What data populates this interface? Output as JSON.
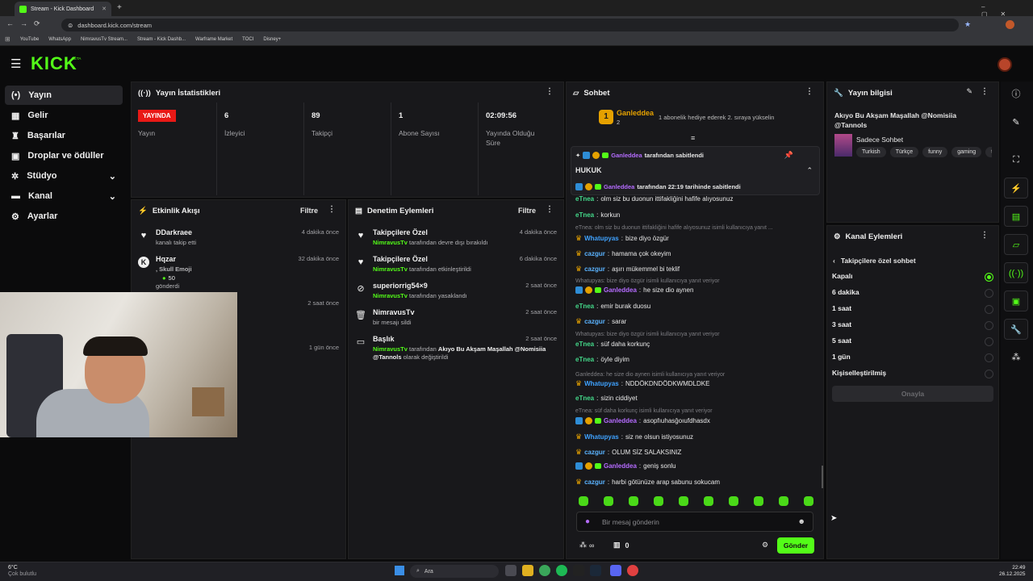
{
  "browser": {
    "tab_title": "Stream - Kick Dashboard",
    "url": "dashboard.kick.com/stream",
    "bookmarks": [
      "YouTube",
      "WhatsApp",
      "NimravusTv Stream...",
      "Stream - Kick Dashb...",
      "Warframe Market",
      "TOCI",
      "Disney+"
    ]
  },
  "site": {
    "logo": "KICK",
    "beta": "BETA"
  },
  "nav": {
    "items": [
      {
        "label": "Yayın",
        "icon": "broadcast-icon"
      },
      {
        "label": "Gelir",
        "icon": "money-icon"
      },
      {
        "label": "Başarılar",
        "icon": "trophy-icon"
      },
      {
        "label": "Droplar ve ödüller",
        "icon": "gift-icon"
      },
      {
        "label": "Stüdyo",
        "icon": "studio-icon"
      },
      {
        "label": "Kanal",
        "icon": "channel-icon"
      },
      {
        "label": "Ayarlar",
        "icon": "gear-icon"
      }
    ]
  },
  "stats": {
    "title": "Yayın İstatistikleri",
    "live_badge": "YAYINDA",
    "live_label": "Yayın",
    "items": [
      {
        "value": "6",
        "label": "İzleyici"
      },
      {
        "value": "89",
        "label": "Takipçi"
      },
      {
        "value": "1",
        "label": "Abone Sayısı"
      },
      {
        "value": "02:09:56",
        "label": "Yayında Olduğu Süre"
      }
    ]
  },
  "activity": {
    "title": "Etkinlik Akışı",
    "filter": "Filtre",
    "items": [
      {
        "name": "DDarkraee",
        "sub": "kanalı takip etti",
        "time": "4 dakika önce"
      },
      {
        "name": "Hqzar",
        "sub": ", Skull Emoji",
        "amount": "50",
        "sub2": "gönderdi",
        "time": "32 dakika önce"
      },
      {
        "time": "2 saat önce"
      },
      {
        "time": "1 gün önce"
      }
    ]
  },
  "moderation": {
    "title": "Denetim Eylemleri",
    "filter": "Filtre",
    "items": [
      {
        "title": "Takipçilere Özel",
        "actor": "NimravusTv",
        "action": "tarafından devre dışı bırakıldı",
        "time": "4 dakika önce"
      },
      {
        "title": "Takipçilere Özel",
        "actor": "NimravusTv",
        "action": "tarafından etkinleştirildi",
        "time": "6 dakika önce"
      },
      {
        "title": "superiorrig54×9",
        "actor": "NimravusTv",
        "action": "tarafından yasaklandı",
        "time": "2 saat önce"
      },
      {
        "title": "NimravusTv",
        "action": "bir mesajı sildi",
        "time": "2 saat önce"
      },
      {
        "title": "Başlık",
        "actor": "NimravusTv",
        "action": "tarafından",
        "target": "Akıyo Bu Akşam Maşallah @Nomisiia @Tannols",
        "action2": "olarak değiştirildi",
        "time": "2 saat önce"
      }
    ]
  },
  "chat": {
    "title": "Sohbet",
    "top_user": "Ganleddea",
    "top_rank": "1",
    "top_count": "2",
    "top_text": "1 abonelik hediye ederek 2. sıraya yükselin",
    "pinned_by": "Ganleddea",
    "pinned_label": "tarafından sabitlendi",
    "pinned_msg": "HUKUK",
    "pinned_time": "tarafından 22:19 tarihinde sabitlendi",
    "messages": [
      {
        "user": "eTnea",
        "text": "olm siz bu duonun ittifakliğini hafife alıyosunuz"
      },
      {
        "user": "eTnea",
        "text": "korkun"
      },
      {
        "reply": "eTnea: olm siz bu duonun ittifakliğini hafife alıyosunuz isimli kullanıcıya yanıt ..."
      },
      {
        "user": "Whatupyas",
        "text": "bize diyo özgür"
      },
      {
        "user": "cazgur",
        "text": "hamama çok okeyim"
      },
      {
        "user": "cazgur",
        "text": "aşırı mükemmel bi teklif"
      },
      {
        "reply": "Whatupyas: bize diyo özgür isimli kullanıcıya yanıt veriyor"
      },
      {
        "user": "Ganleddea",
        "text": "he size dio aynen"
      },
      {
        "user": "eTnea",
        "text": "emir burak duosu"
      },
      {
        "user": "cazgur",
        "text": "sarar"
      },
      {
        "reply": "Whatupyas: bize diyo özgür isimli kullanıcıya yanıt veriyor"
      },
      {
        "user": "eTnea",
        "text": "süf daha korkunç"
      },
      {
        "user": "eTnea",
        "text": "öyle diyim"
      },
      {
        "reply": "Ganleddea: he size dio aynen isimli kullanıcıya yanıt veriyor"
      },
      {
        "user": "Whatupyas",
        "text": "NDDÖKDNDÖDKWMDLDKE"
      },
      {
        "user": "eTnea",
        "text": "sizin ciddiyet"
      },
      {
        "reply": "eTnea: süf daha korkunç isimli kullanıcıya yanıt veriyor"
      },
      {
        "user": "Ganleddea",
        "text": "asopfıuhasğoıufdhasdx"
      },
      {
        "user": "Whatupyas",
        "text": "siz ne olsun istiyosunuz"
      },
      {
        "user": "cazgur",
        "text": "OLUM SİZ SALAKSINIZ"
      },
      {
        "user": "Ganleddea",
        "text": "geniş sonlu"
      },
      {
        "user": "cazgur",
        "text": "harbi götünüze arap sabunu sokucam"
      }
    ],
    "input_placeholder": "Bir mesaj gönderin",
    "points": "0",
    "send": "Gönder"
  },
  "info": {
    "title": "Yayın bilgisi",
    "stream_title": "Akıyo Bu Akşam Maşallah @Nomisiia @Tannols",
    "category": "Sadece Sohbet",
    "tags": [
      "Turkish",
      "Türkçe",
      "funny",
      "gaming",
      "t"
    ]
  },
  "channel_actions": {
    "title": "Kanal Eylemleri",
    "sub": "Takipçilere özel sohbet",
    "options": [
      {
        "label": "Kapalı",
        "selected": true
      },
      {
        "label": "6 dakika"
      },
      {
        "label": "1 saat"
      },
      {
        "label": "3 saat"
      },
      {
        "label": "5 saat"
      },
      {
        "label": "1 gün"
      },
      {
        "label": "Kişiselleştirilmiş"
      }
    ],
    "confirm": "Onayla"
  },
  "taskbar": {
    "weather": "6°C",
    "weather_sub": "Çok bulutlu",
    "search": "Ara",
    "time": "22:49",
    "date": "26.12.2025"
  },
  "colors": {
    "accent": "#53fc18",
    "live": "#e91916",
    "bg": "#0b0b0c",
    "panel": "#18181b"
  }
}
